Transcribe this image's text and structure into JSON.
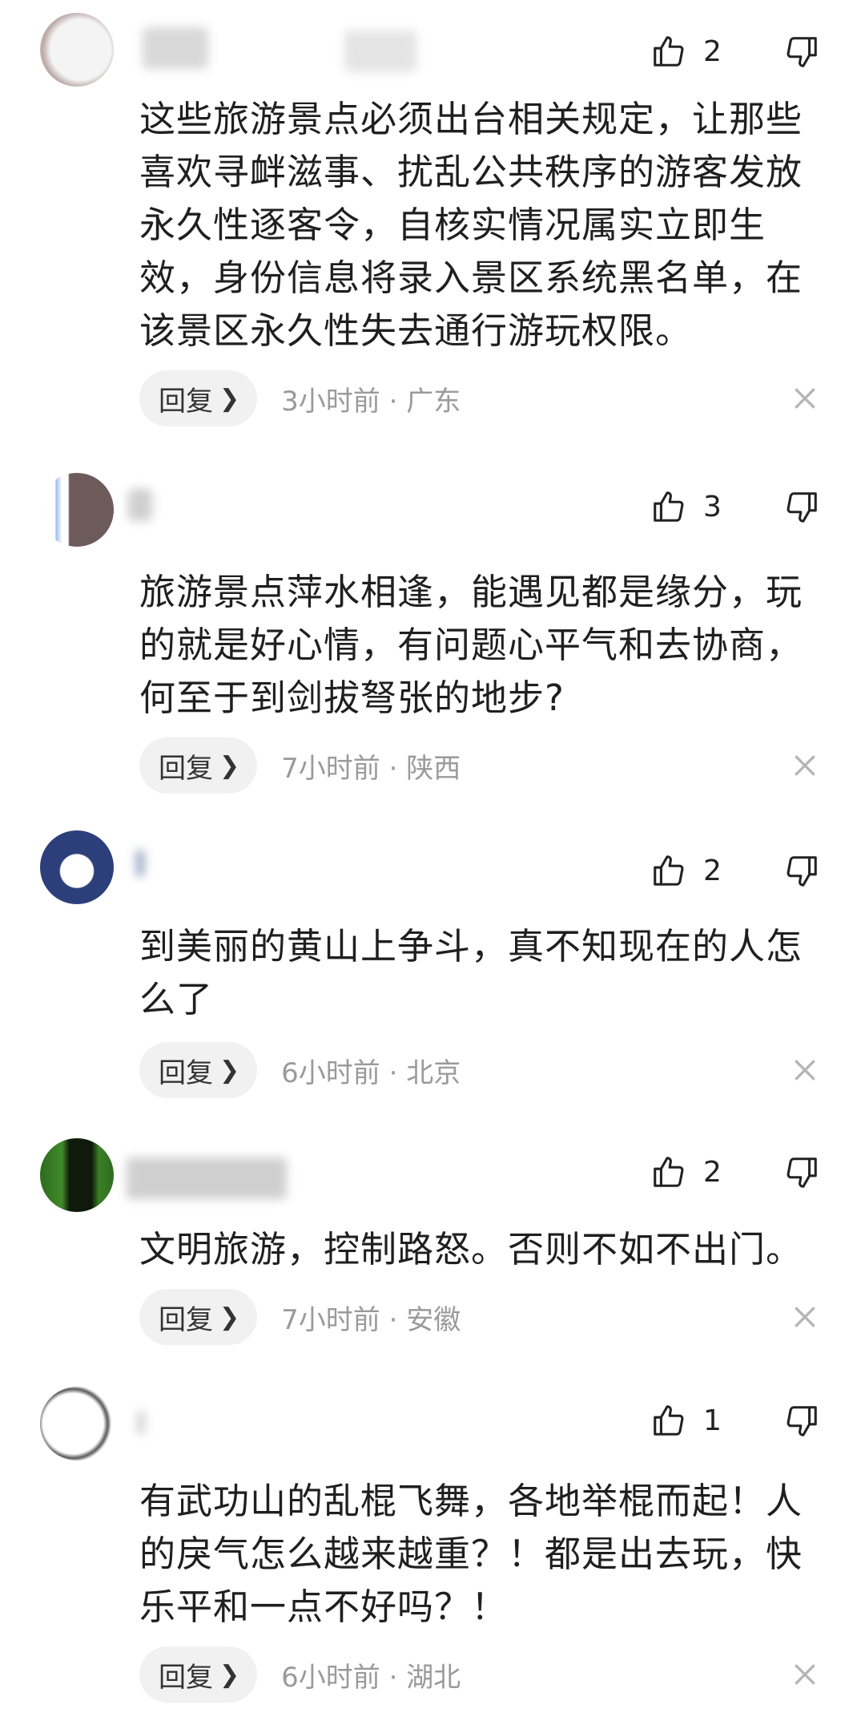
{
  "comments": [
    {
      "likes": "2",
      "text": "这些旅游景点必须出台相关规定，让那些喜欢寻衅滋事、扰乱公共秩序的游客发放永久性逐客令，自核实情况属实立即生效，身份信息将录入景区系统黑名单，在该景区永久性失去通行游玩权限。",
      "reply_label": "回复",
      "time_location": "3小时前 · 广东"
    },
    {
      "likes": "3",
      "text": "旅游景点萍水相逢，能遇见都是缘分，玩的就是好心情，有问题心平气和去协商，何至于到剑拔弩张的地步?",
      "reply_label": "回复",
      "time_location": "7小时前 · 陕西"
    },
    {
      "likes": "2",
      "text": "到美丽的黄山上争斗，真不知现在的人怎么了",
      "reply_label": "回复",
      "time_location": "6小时前 · 北京"
    },
    {
      "likes": "2",
      "text": "文明旅游，控制路怒。否则不如不出门。",
      "reply_label": "回复",
      "time_location": "7小时前 · 安徽"
    },
    {
      "likes": "1",
      "text": "有武功山的乱棍飞舞，各地举棍而起！人的戾气怎么越来越重？！都是出去玩，快乐平和一点不好吗？！",
      "reply_label": "回复",
      "time_location": "6小时前 · 湖北"
    }
  ],
  "icons": {
    "like": "thumbs-up-icon",
    "dislike": "thumbs-down-icon",
    "reply_chevron": "chevron-right-icon",
    "dismiss": "close-icon"
  }
}
